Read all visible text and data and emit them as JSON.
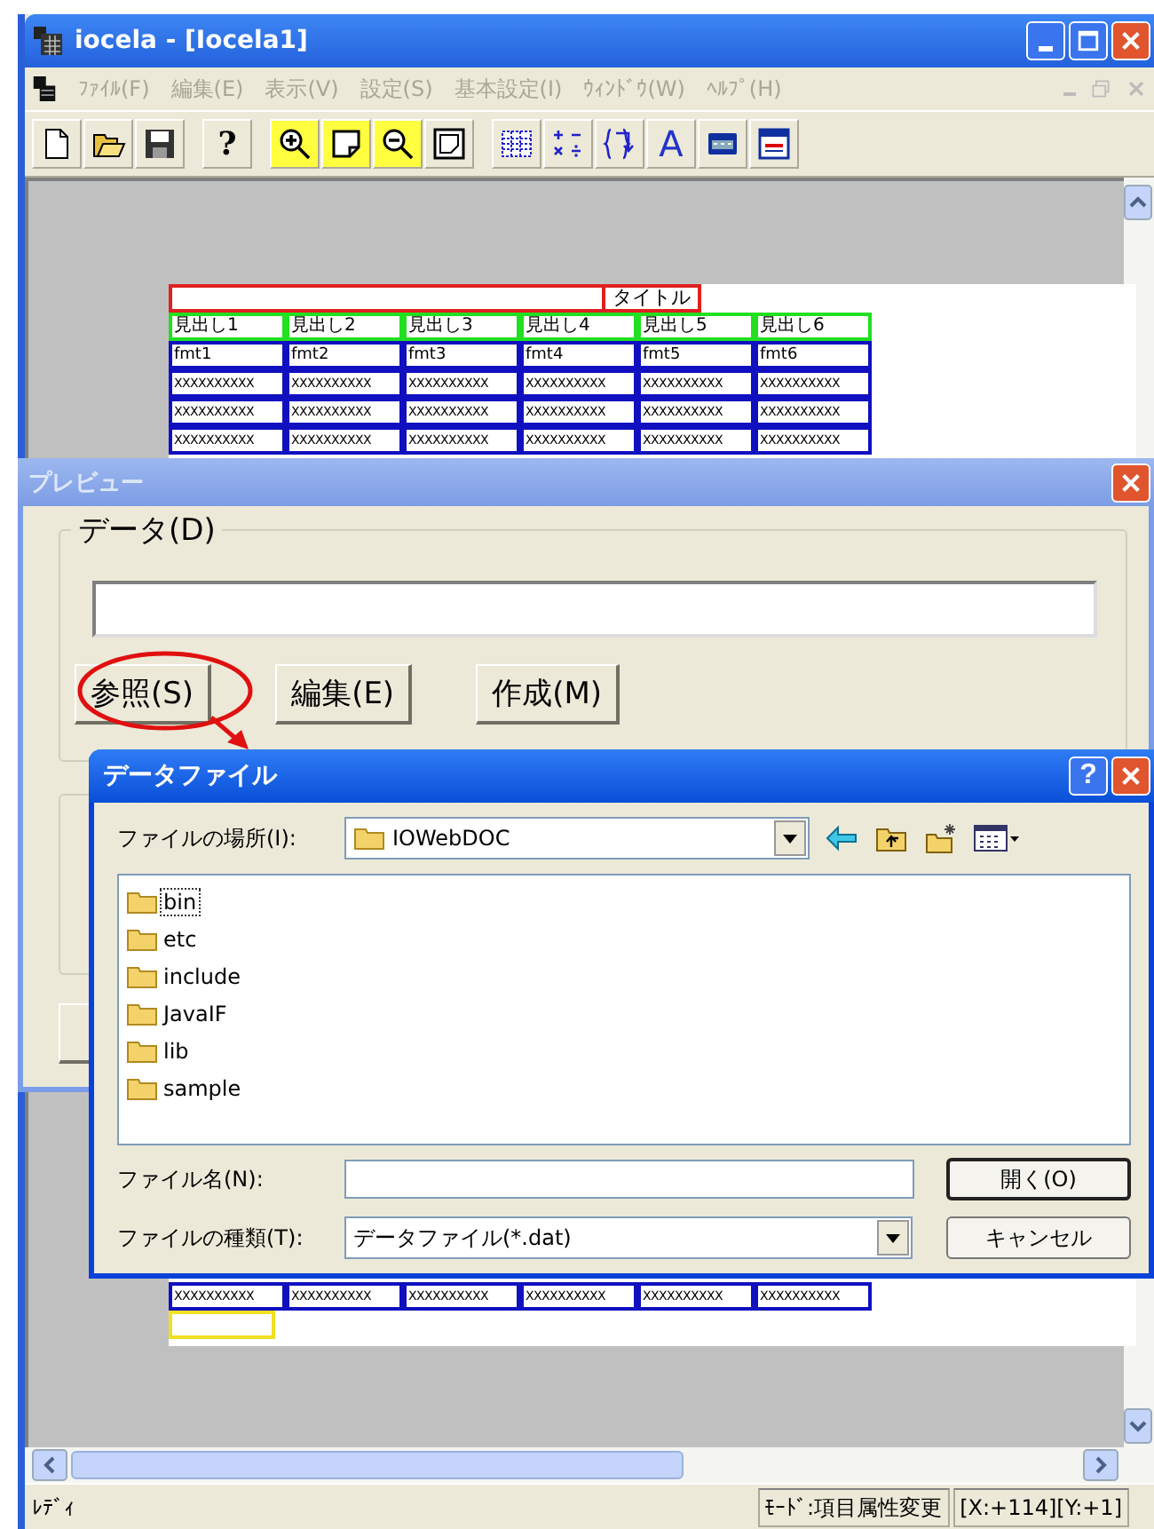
{
  "window": {
    "title": "iocela - [Iocela1]"
  },
  "menu": [
    {
      "label": "ﾌｧｲﾙ(F)",
      "disabled": true
    },
    {
      "label": "編集(E)",
      "disabled": true
    },
    {
      "label": "表示(V)",
      "disabled": true
    },
    {
      "label": "設定(S)",
      "disabled": true
    },
    {
      "label": "基本設定(I)",
      "disabled": true
    },
    {
      "label": "ｳｨﾝﾄﾞｳ(W)",
      "disabled": true
    },
    {
      "label": "ﾍﾙﾌﾟ(H)",
      "disabled": true
    }
  ],
  "toolbar": [
    [
      {
        "kind": "new",
        "highlighted": false
      },
      {
        "kind": "open",
        "highlighted": false
      },
      {
        "kind": "save",
        "highlighted": false
      }
    ],
    [
      {
        "kind": "help",
        "label": "?",
        "highlighted": false
      }
    ],
    [
      {
        "kind": "zoom-in",
        "highlighted": true
      },
      {
        "kind": "page",
        "highlighted": true
      },
      {
        "kind": "zoom-out",
        "highlighted": true
      },
      {
        "kind": "frame",
        "highlighted": false
      }
    ],
    [
      {
        "kind": "grid",
        "highlighted": false
      },
      {
        "kind": "calc",
        "highlighted": false
      },
      {
        "kind": "brace",
        "highlighted": false
      },
      {
        "kind": "text",
        "label": "A",
        "highlighted": false
      },
      {
        "kind": "form",
        "highlighted": false
      },
      {
        "kind": "form2",
        "highlighted": false
      }
    ]
  ],
  "sheet": {
    "title": "タイトル",
    "headers": [
      "見出し1",
      "見出し2",
      "見出し3",
      "見出し4",
      "見出し5",
      "見出し6"
    ],
    "formats": [
      "fmt1",
      "fmt2",
      "fmt3",
      "fmt4",
      "fmt5",
      "fmt6"
    ],
    "rows": [
      [
        "XXXXXXXXXX",
        "XXXXXXXXXX",
        "XXXXXXXXXX",
        "XXXXXXXXXX",
        "XXXXXXXXXX",
        "XXXXXXXXXX"
      ],
      [
        "XXXXXXXXXX",
        "XXXXXXXXXX",
        "XXXXXXXXXX",
        "XXXXXXXXXX",
        "XXXXXXXXXX",
        "XXXXXXXXXX"
      ],
      [
        "XXXXXXXXXX",
        "XXXXXXXXXX",
        "XXXXXXXXXX",
        "XXXXXXXXXX",
        "XXXXXXXXXX",
        "XXXXXXXXXX"
      ]
    ],
    "bottom_rows": [
      [
        "XXXXXXXXXX",
        "XXXXXXXXXX",
        "XXXXXXXXXX",
        "XXXXXXXXXX",
        "XXXXXXXXXX",
        "XXXXXXXXXX"
      ]
    ]
  },
  "preview": {
    "title": "プレビュー",
    "group_label": "データ(D)",
    "buttons": [
      "参照(S)",
      "編集(E)",
      "作成(M)"
    ]
  },
  "file_dialog": {
    "title": "データファイル",
    "help": "?",
    "location_label": "ファイルの場所(I):",
    "location": "IOWebDOC",
    "files": [
      {
        "name": "bin",
        "focused": true
      },
      {
        "name": "etc",
        "focused": false
      },
      {
        "name": "include",
        "focused": false
      },
      {
        "name": "JavaIF",
        "focused": false
      },
      {
        "name": "lib",
        "focused": false
      },
      {
        "name": "sample",
        "focused": false
      }
    ],
    "filename_label": "ファイル名(N):",
    "type_label": "ファイルの種類(T):",
    "type": "データファイル(*.dat)",
    "buttons": [
      "開く(O)",
      "キャンセル"
    ]
  },
  "status_bar": {
    "message": "ﾚﾃﾞｨ",
    "mode": "ﾓｰﾄﾞ:項目属性変更",
    "position": "[X:+114][Y:+1]"
  }
}
